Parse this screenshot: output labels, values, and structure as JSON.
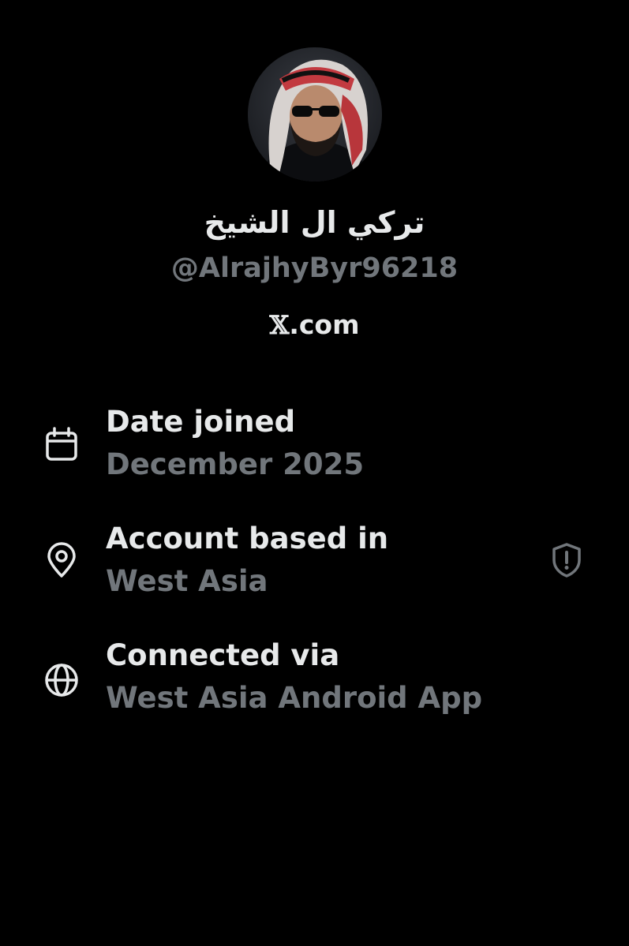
{
  "profile": {
    "display_name": "تركي ال الشيخ",
    "handle": "@AlrajhyByr96218",
    "source_x": "𝕏",
    "source_domain": ".com",
    "avatar": "profile-photo"
  },
  "about": {
    "rows": [
      {
        "label": "Date joined",
        "value": "December 2025",
        "icon": "calendar-icon"
      },
      {
        "label": "Account based in",
        "value": "West Asia",
        "icon": "location-pin-icon",
        "trailing_icon": "shield-alert-icon"
      },
      {
        "label": "Connected via",
        "value": "West Asia Android App",
        "icon": "globe-icon"
      }
    ]
  },
  "colors": {
    "background": "#000000",
    "primary_text": "#e7e9ea",
    "secondary_text": "#71767b"
  }
}
